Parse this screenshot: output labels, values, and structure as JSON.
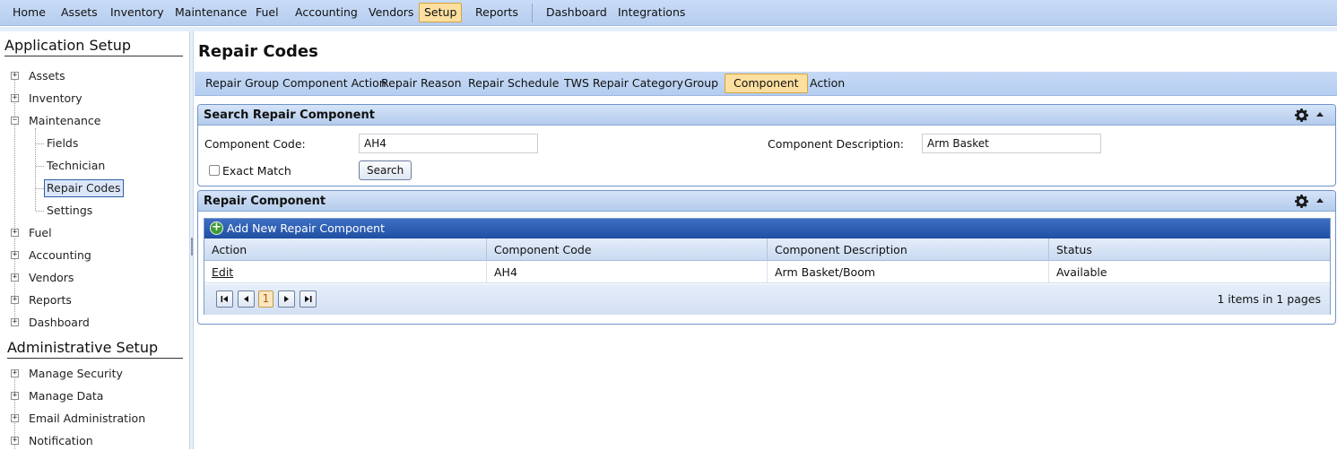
{
  "menu": {
    "items": [
      "Home",
      "Assets",
      "Inventory",
      "Maintenance",
      "Fuel",
      "Accounting",
      "Vendors",
      "Setup",
      "Reports",
      "Dashboard",
      "Integrations"
    ],
    "active": "Setup"
  },
  "sidebar": {
    "app_setup_title": "Application Setup",
    "admin_setup_title": "Administrative Setup",
    "app_items": [
      "Assets",
      "Inventory",
      "Maintenance",
      "Fuel",
      "Accounting",
      "Vendors",
      "Reports",
      "Dashboard"
    ],
    "maintenance_children": [
      "Fields",
      "Technician",
      "Repair Codes",
      "Settings"
    ],
    "selected": "Repair Codes",
    "admin_items": [
      "Manage Security",
      "Manage Data",
      "Email Administration",
      "Notification"
    ]
  },
  "page": {
    "title": "Repair Codes"
  },
  "tabs": {
    "items": [
      "Repair Group Component Action",
      "Repair Reason",
      "Repair Schedule",
      "TWS Repair Category",
      "Group",
      "Component",
      "Action"
    ],
    "active": "Component"
  },
  "search_panel": {
    "title": "Search Repair Component",
    "code_label": "Component Code:",
    "code_value": "AH4",
    "desc_label": "Component Description:",
    "desc_value": "Arm Basket",
    "exact_match_label": "Exact Match",
    "exact_match_checked": false,
    "search_button": "Search"
  },
  "grid_panel": {
    "title": "Repair Component",
    "add_label": "Add New Repair Component",
    "columns": [
      "Action",
      "Component Code",
      "Component Description",
      "Status"
    ],
    "rows": [
      {
        "action": "Edit",
        "code": "AH4",
        "description": "Arm Basket/Boom",
        "status": "Available"
      }
    ],
    "current_page": "1",
    "pager_info": "1 items in 1 pages"
  },
  "colors": {
    "accent_active": "#fde0a0",
    "header_blue": "#1f4fa3",
    "add_green": "#3f9b35"
  },
  "icons": {
    "panel_settings": "gear-icon",
    "panel_collapse": "chevron-up-icon",
    "add": "plus-circle-icon",
    "tree_expand": "plus-box-icon",
    "tree_collapse": "minus-box-icon"
  }
}
